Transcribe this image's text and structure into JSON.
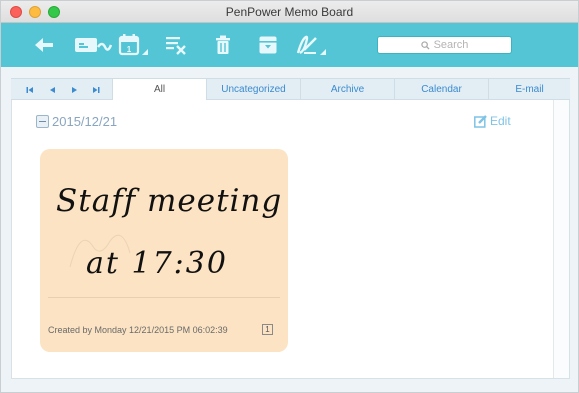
{
  "window": {
    "title": "PenPower Memo Board"
  },
  "toolbar": {
    "buttons": [
      {
        "icon": "back-arrow-icon"
      },
      {
        "icon": "send-memo-icon"
      },
      {
        "icon": "calendar-icon"
      },
      {
        "icon": "clear-list-icon"
      },
      {
        "icon": "trash-icon"
      },
      {
        "icon": "archive-box-icon"
      },
      {
        "icon": "pen-signature-icon"
      }
    ],
    "search_placeholder": "Search"
  },
  "tabs": {
    "nav": [
      "first",
      "previous",
      "next",
      "last"
    ],
    "items": [
      "All",
      "Uncategorized",
      "Archive",
      "Calendar",
      "E-mail"
    ],
    "active": "All"
  },
  "content": {
    "date": "2015/12/21",
    "edit_label": "Edit",
    "memo": {
      "handwriting_line1": "Staff meeting",
      "handwriting_line2": "at 17:30",
      "footer": "Created by Monday 12/21/2015 PM 06:02:39",
      "page_count": "1",
      "background": "#fbe3c3"
    }
  },
  "colors": {
    "toolbar": "#54c5d4",
    "accent": "#3b8ad0"
  }
}
